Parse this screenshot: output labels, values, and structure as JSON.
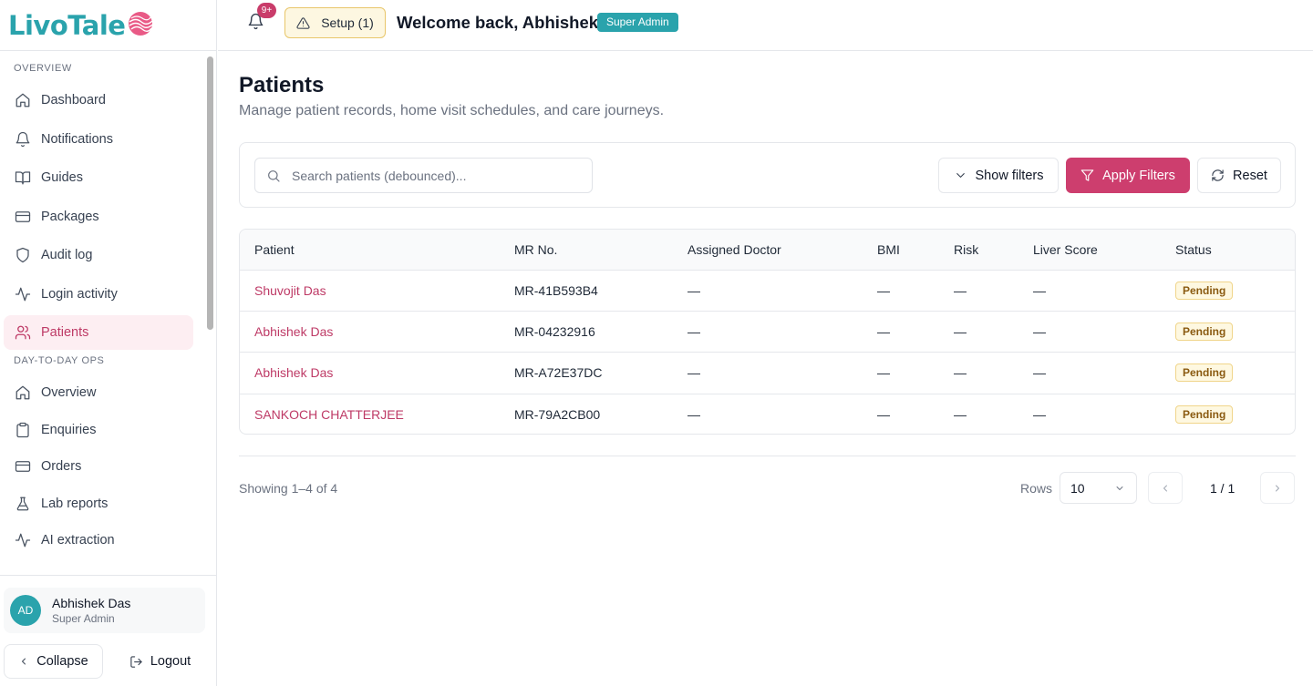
{
  "brand": {
    "name": "LivoTale"
  },
  "sidebar": {
    "sections": [
      {
        "title": "OVERVIEW",
        "items": [
          {
            "label": "Dashboard",
            "icon": "home-icon"
          },
          {
            "label": "Notifications",
            "icon": "bell-icon"
          },
          {
            "label": "Guides",
            "icon": "book-icon"
          },
          {
            "label": "Packages",
            "icon": "card-icon"
          },
          {
            "label": "Audit log",
            "icon": "shield-icon"
          },
          {
            "label": "Login activity",
            "icon": "activity-icon"
          },
          {
            "label": "Patients",
            "icon": "users-icon",
            "active": true
          }
        ]
      },
      {
        "title": "DAY-TO-DAY OPS",
        "items": [
          {
            "label": "Overview",
            "icon": "home-icon"
          },
          {
            "label": "Enquiries",
            "icon": "clipboard-icon"
          },
          {
            "label": "Orders",
            "icon": "card-icon"
          },
          {
            "label": "Lab reports",
            "icon": "flask-icon"
          },
          {
            "label": "AI extraction",
            "icon": "activity-icon"
          }
        ]
      }
    ],
    "user": {
      "initials": "AD",
      "name": "Abhishek Das",
      "role": "Super Admin"
    },
    "collapse_label": "Collapse",
    "logout_label": "Logout"
  },
  "header": {
    "notification_count": "9+",
    "setup_label": "Setup (1)",
    "welcome": "Welcome back, Abhishek",
    "role_badge": "Super Admin"
  },
  "page": {
    "title": "Patients",
    "subtitle": "Manage patient records, home visit schedules, and care journeys."
  },
  "filters": {
    "search_placeholder": "Search patients (debounced)...",
    "show_filters_label": "Show filters",
    "apply_label": "Apply Filters",
    "reset_label": "Reset"
  },
  "table": {
    "headers": [
      "Patient",
      "MR No.",
      "Assigned Doctor",
      "BMI",
      "Risk",
      "Liver Score",
      "Status"
    ],
    "rows": [
      {
        "patient": "Shuvojit Das",
        "mr": "MR-41B593B4",
        "doctor": "—",
        "bmi": "—",
        "risk": "—",
        "liver": "—",
        "status": "Pending"
      },
      {
        "patient": "Abhishek Das",
        "mr": "MR-04232916",
        "doctor": "—",
        "bmi": "—",
        "risk": "—",
        "liver": "—",
        "status": "Pending"
      },
      {
        "patient": "Abhishek Das",
        "mr": "MR-A72E37DC",
        "doctor": "—",
        "bmi": "—",
        "risk": "—",
        "liver": "—",
        "status": "Pending"
      },
      {
        "patient": "SANKOCH CHATTERJEE",
        "mr": "MR-79A2CB00",
        "doctor": "—",
        "bmi": "—",
        "risk": "—",
        "liver": "—",
        "status": "Pending"
      }
    ]
  },
  "pagination": {
    "showing": "Showing 1–4 of 4",
    "rows_label": "Rows",
    "rows_value": "10",
    "page_indicator": "1 / 1"
  },
  "colors": {
    "brand_teal": "#2aa3ac",
    "accent_pink": "#cd3e6e",
    "active_bg": "#fdeef2",
    "pending_bg": "#fef8e1"
  }
}
